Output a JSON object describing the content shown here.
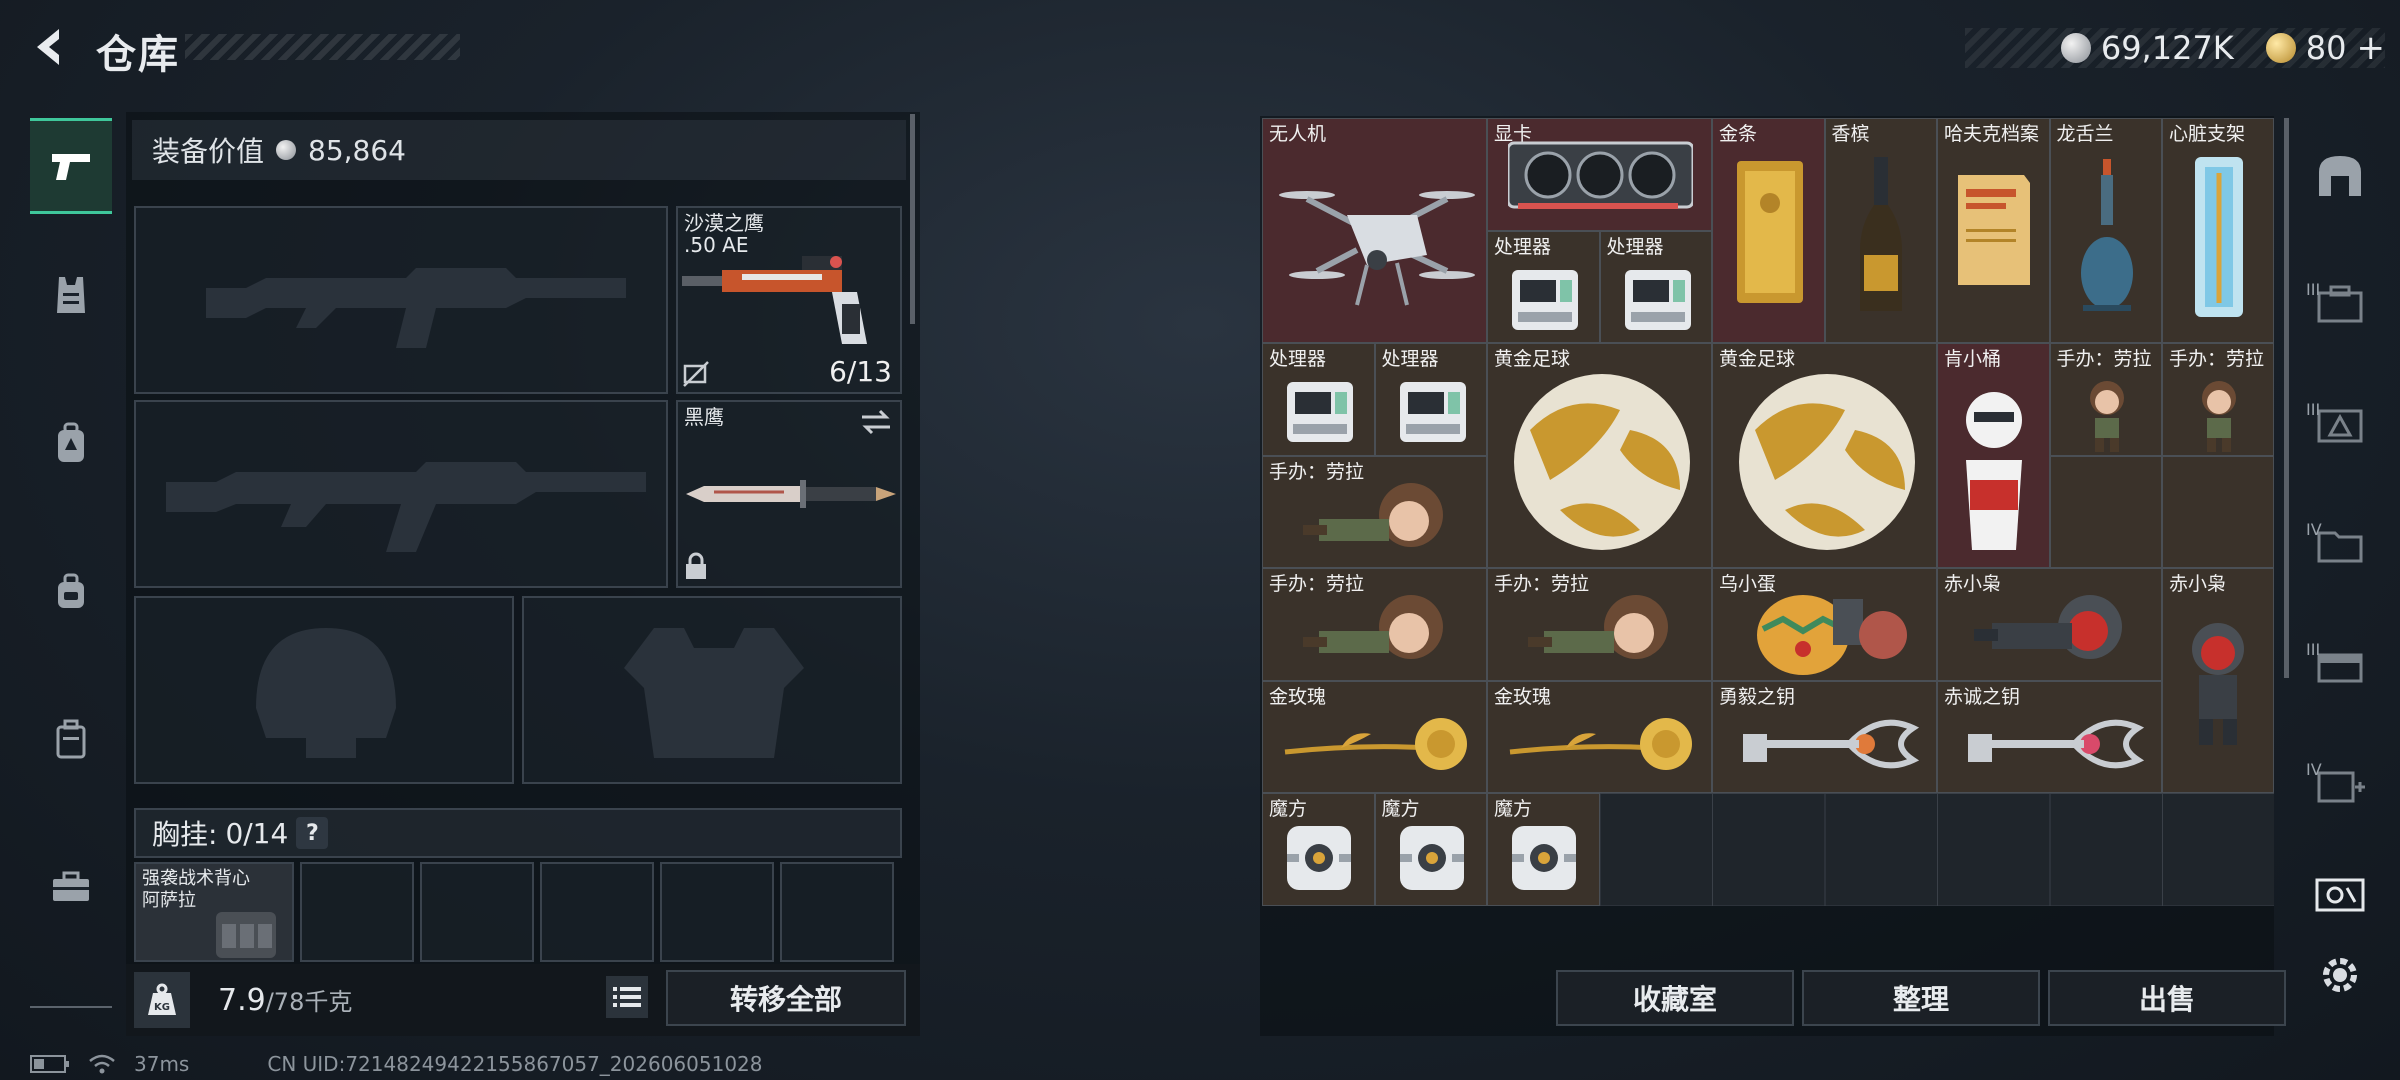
{
  "header": {
    "back_icon": "back-arrow-icon",
    "title": "仓库"
  },
  "currency": [
    {
      "icon": "silver-coin-icon",
      "value": "69,127K",
      "color": "#c9cdd2"
    },
    {
      "icon": "gold-coin-icon",
      "value": "80",
      "color": "#d8a84a"
    }
  ],
  "currency_plus": "+",
  "left_nav": [
    {
      "icon": "pistol-icon",
      "active": true
    },
    {
      "icon": "vest-icon",
      "active": false
    },
    {
      "icon": "backpack-icon",
      "active": false
    },
    {
      "icon": "bag-icon",
      "active": false
    },
    {
      "icon": "case-icon",
      "active": false
    },
    {
      "icon": "toolbox-icon",
      "active": false
    }
  ],
  "equipment": {
    "label": "装备价值",
    "value": "85,864",
    "sidearm": {
      "name": "沙漠之鹰",
      "caliber": ".50 AE",
      "ammo": "6/13"
    },
    "melee": {
      "name": "黑鹰"
    },
    "chest_rig": {
      "label": "胸挂:",
      "count": "0/14",
      "help": "?"
    },
    "chest_item": {
      "line1": "强袭战术背心",
      "line2": "阿萨拉"
    }
  },
  "weight": {
    "badge": "KG",
    "current": "7.9",
    "max": "/78千克"
  },
  "buttons": {
    "transfer_all": "转移全部",
    "collection": "收藏室",
    "sort": "整理",
    "sell": "出售"
  },
  "grid_items": [
    {
      "name": "无人机",
      "bg": "red"
    },
    {
      "name": "显卡",
      "bg": "red"
    },
    {
      "name": "处理器",
      "bg": "brown"
    },
    {
      "name": "处理器",
      "bg": "brown"
    },
    {
      "name": "金条",
      "bg": "brown"
    },
    {
      "name": "香槟",
      "bg": "brown"
    },
    {
      "name": "哈夫克档案",
      "bg": "brown"
    },
    {
      "name": "龙舌兰",
      "bg": "brown"
    },
    {
      "name": "心脏支架",
      "bg": "brown"
    },
    {
      "name": "处理器",
      "bg": "brown"
    },
    {
      "name": "处理器",
      "bg": "brown"
    },
    {
      "name": "黄金足球",
      "bg": "brown"
    },
    {
      "name": "黄金足球",
      "bg": "brown"
    },
    {
      "name": "肯小桶",
      "bg": "red"
    },
    {
      "name": "手办：劳拉",
      "bg": "brown"
    },
    {
      "name": "手办：劳拉",
      "bg": "brown"
    },
    {
      "name": "手办：劳拉",
      "bg": "brown"
    },
    {
      "name": "手办：劳拉",
      "bg": "brown"
    },
    {
      "name": "手办：劳拉",
      "bg": "brown"
    },
    {
      "name": "乌小蛋",
      "bg": "brown"
    },
    {
      "name": "赤小枭",
      "bg": "brown"
    },
    {
      "name": "赤小枭",
      "bg": "brown"
    },
    {
      "name": "金玫瑰",
      "bg": "brown"
    },
    {
      "name": "金玫瑰",
      "bg": "brown"
    },
    {
      "name": "勇毅之钥",
      "bg": "brown"
    },
    {
      "name": "赤诚之钥",
      "bg": "brown"
    },
    {
      "name": "魔方",
      "bg": "brown"
    },
    {
      "name": "魔方",
      "bg": "brown"
    },
    {
      "name": "魔方",
      "bg": "brown"
    }
  ],
  "right_tabs": [
    {
      "icon": "arch-icon",
      "roman": ""
    },
    {
      "icon": "case-III-icon",
      "roman": "III"
    },
    {
      "icon": "case-III-triangle-icon",
      "roman": "III"
    },
    {
      "icon": "folder-IV-icon",
      "roman": "IV"
    },
    {
      "icon": "box-III-icon",
      "roman": "III"
    },
    {
      "icon": "add-IV-icon",
      "roman": "IV"
    },
    {
      "icon": "ticket-icon",
      "roman": ""
    },
    {
      "icon": "gear-icon",
      "roman": ""
    }
  ],
  "status": {
    "ping": "37ms",
    "uid": "CN UID:7214824942215586705​7_202606051028"
  }
}
